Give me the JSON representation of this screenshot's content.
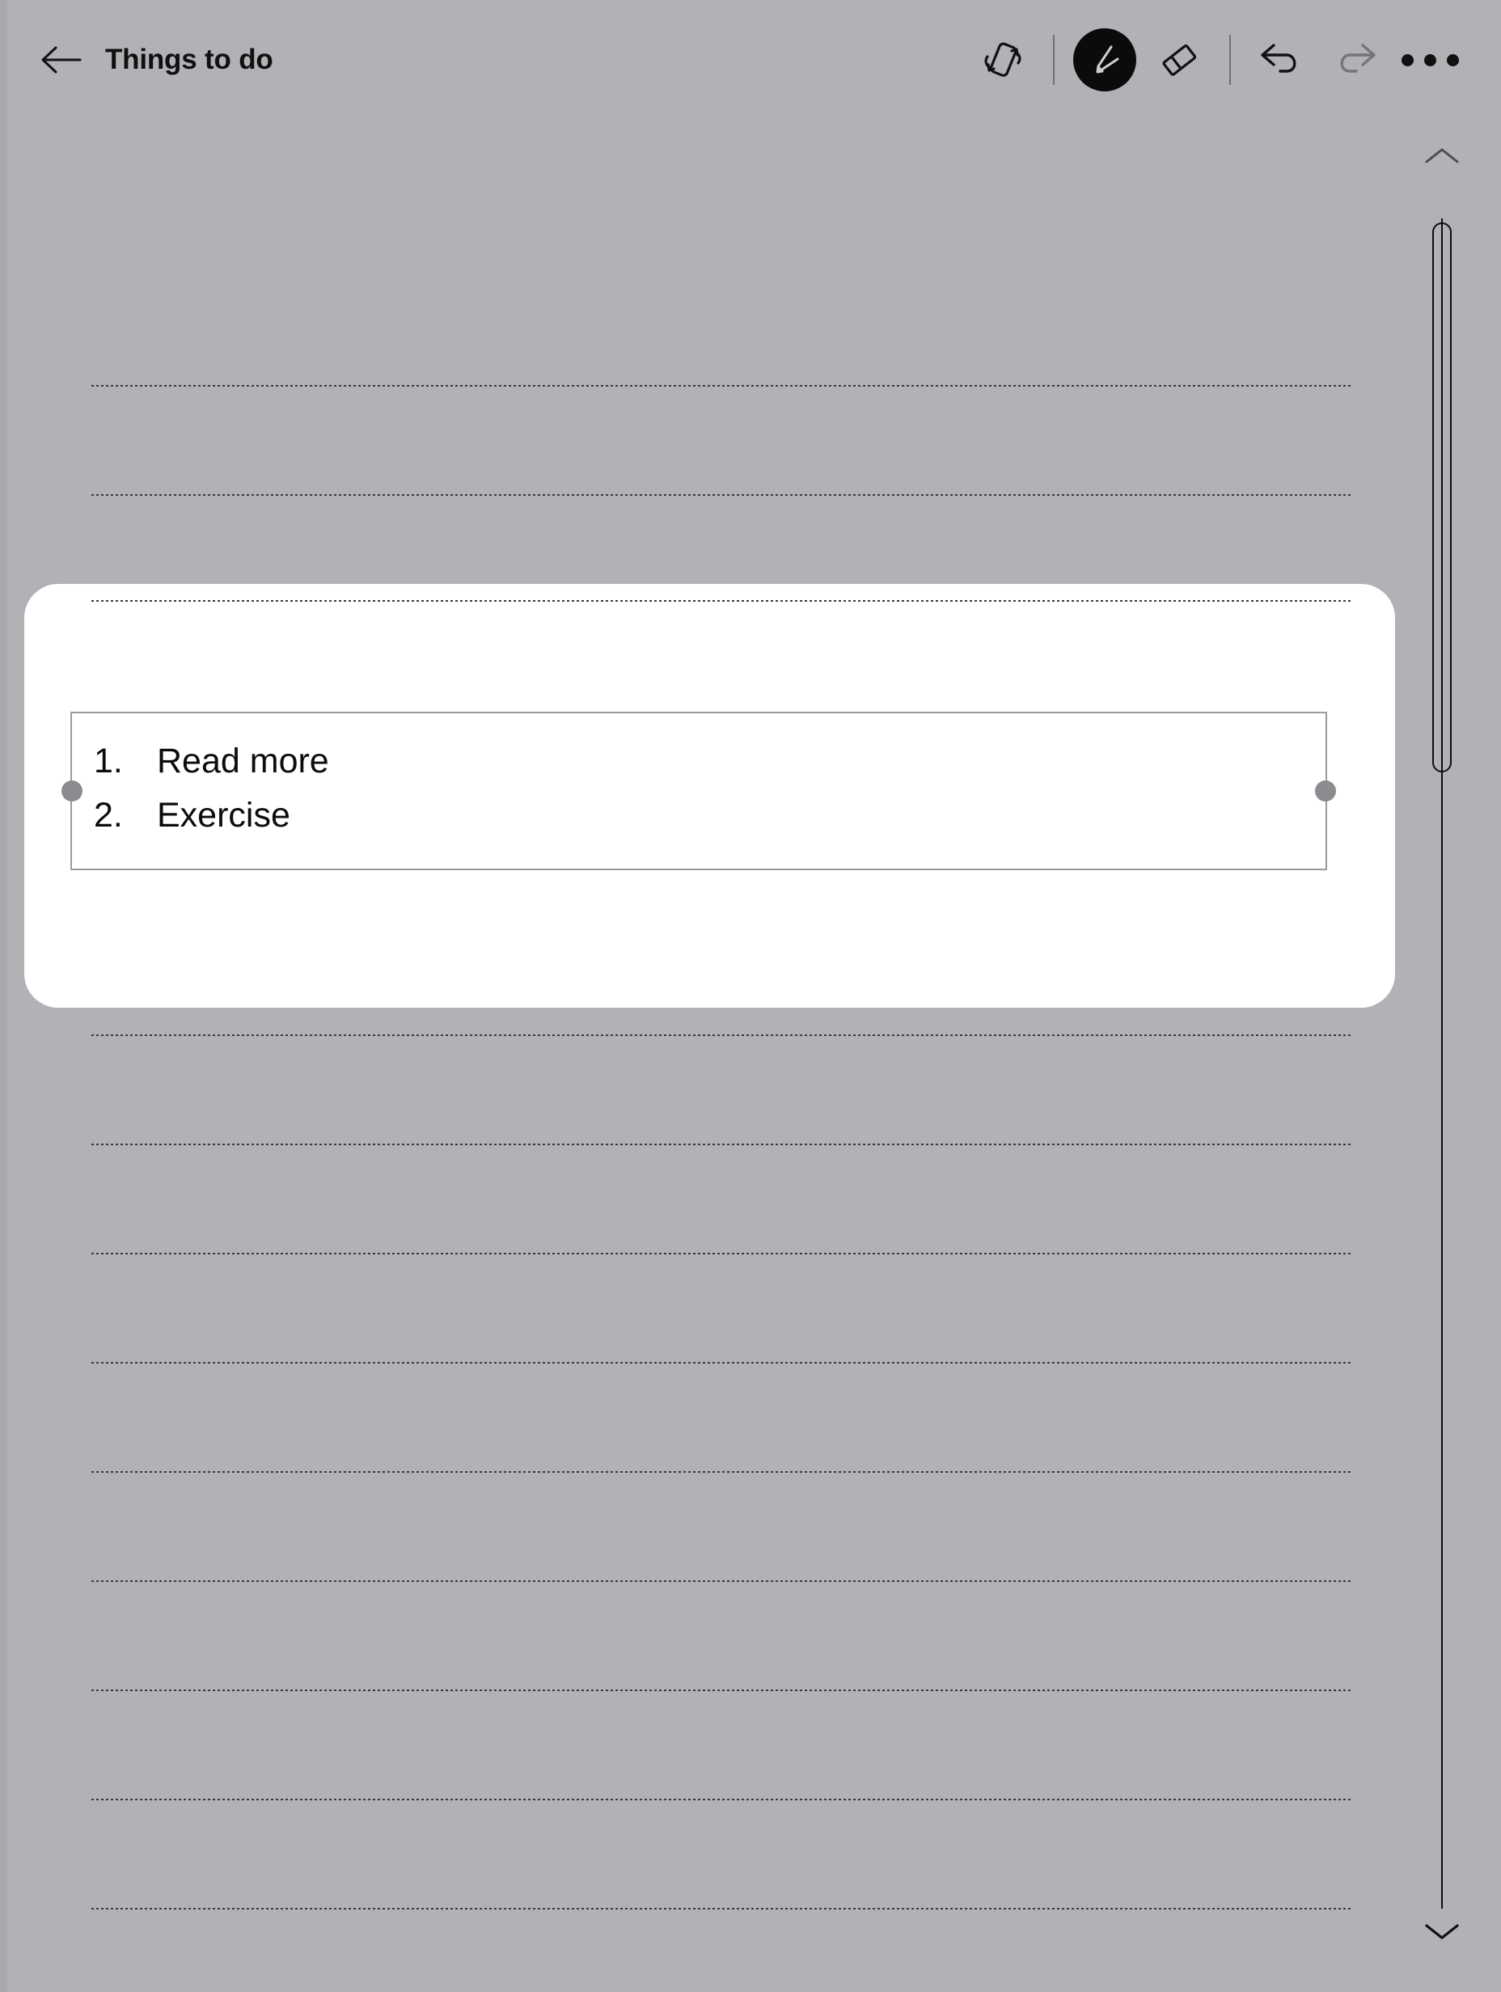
{
  "app": {
    "background_color": "#b1b2b6",
    "card_color": "#ffffff"
  },
  "header": {
    "back_label": "back-arrow",
    "title": "Things to do",
    "tools": [
      {
        "name": "rotate-screen-icon",
        "label": "Rotate screen",
        "selected": false
      },
      {
        "name": "pen-icon",
        "label": "Pen",
        "selected": true
      },
      {
        "name": "eraser-icon",
        "label": "Eraser",
        "selected": false
      }
    ],
    "history": [
      {
        "name": "undo-icon",
        "label": "Undo",
        "enabled": true
      },
      {
        "name": "redo-icon",
        "label": "Redo",
        "enabled": false
      }
    ],
    "more_label": "More options"
  },
  "note": {
    "ruled_line_count": 16,
    "textbox": {
      "list_type": "ordered",
      "items": [
        {
          "number": "1.",
          "text": "Read more"
        },
        {
          "number": "2.",
          "text": "Exercise"
        }
      ],
      "handles": [
        "left-resize-handle",
        "right-resize-handle"
      ]
    }
  },
  "scrollbar": {
    "up_label": "Scroll up",
    "down_label": "Scroll down",
    "thumb_label": "Scroll thumb"
  }
}
